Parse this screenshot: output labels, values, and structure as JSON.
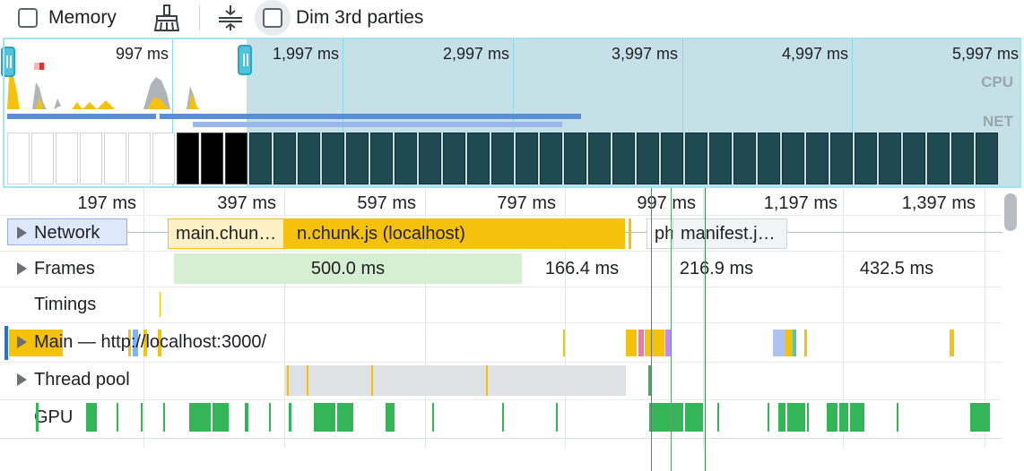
{
  "toolbar": {
    "memory_label": "Memory",
    "broom_icon": "broom-icon",
    "collapse_icon": "collapse-vertical-icon",
    "dim_label": "Dim 3rd parties"
  },
  "overview": {
    "time_labels": [
      "997 ms",
      "1,997 ms",
      "2,997 ms",
      "3,997 ms",
      "4,997 ms",
      "5,997 ms"
    ],
    "cpu_label": "CPU",
    "net_label": "NET",
    "colors": {
      "selection": "#5aaab9",
      "cpu_script": "#f4c20d",
      "cpu_other": "#b0b4b8",
      "net": "#5b8fd4"
    }
  },
  "timeline": {
    "ruler_labels": [
      "197 ms",
      "397 ms",
      "597 ms",
      "797 ms",
      "997 ms",
      "1,197 ms",
      "1,397 ms"
    ],
    "tracks": {
      "network": "Network",
      "frames": "Frames",
      "timings": "Timings",
      "main": "Main — http://localhost:3000/",
      "thread_pool": "Thread pool",
      "gpu": "GPU"
    },
    "network_requests": {
      "main_chunk_1": "main.chun…",
      "main_chunk_2": "n.chunk.js (localhost)",
      "ph": "ph",
      "manifest": "manifest.j…"
    },
    "frames": [
      "500.0 ms",
      "166.4 ms",
      "216.9 ms",
      "432.5 ms"
    ],
    "colors": {
      "script": "#f4c20d",
      "gpu": "#34b558",
      "frame": "#d6eed2",
      "idle": "#dfe2e4"
    }
  }
}
